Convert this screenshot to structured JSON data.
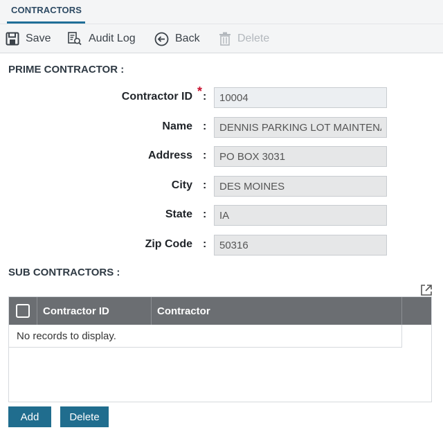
{
  "tabs": {
    "active": "CONTRACTORS"
  },
  "toolbar": {
    "save": "Save",
    "audit_log": "Audit Log",
    "back": "Back",
    "delete": "Delete"
  },
  "prime": {
    "heading": "PRIME CONTRACTOR :",
    "fields": [
      {
        "label": "Contractor ID",
        "value": "10004",
        "required": true
      },
      {
        "label": "Name",
        "value": "DENNIS PARKING LOT MAINTENANCE"
      },
      {
        "label": "Address",
        "value": "PO BOX 3031"
      },
      {
        "label": "City",
        "value": "DES MOINES"
      },
      {
        "label": "State",
        "value": "IA"
      },
      {
        "label": "Zip Code",
        "value": "50316"
      }
    ],
    "colon": ":",
    "required_mark": "*"
  },
  "sub": {
    "heading": "SUB CONTRACTORS :",
    "columns": [
      "Contractor ID",
      "Contractor"
    ],
    "empty_message": "No records to display."
  },
  "actions": {
    "add": "Add",
    "delete": "Delete"
  },
  "colors": {
    "accent": "#206d8e",
    "grid_header": "#6b6e72",
    "required": "#c8102e"
  }
}
